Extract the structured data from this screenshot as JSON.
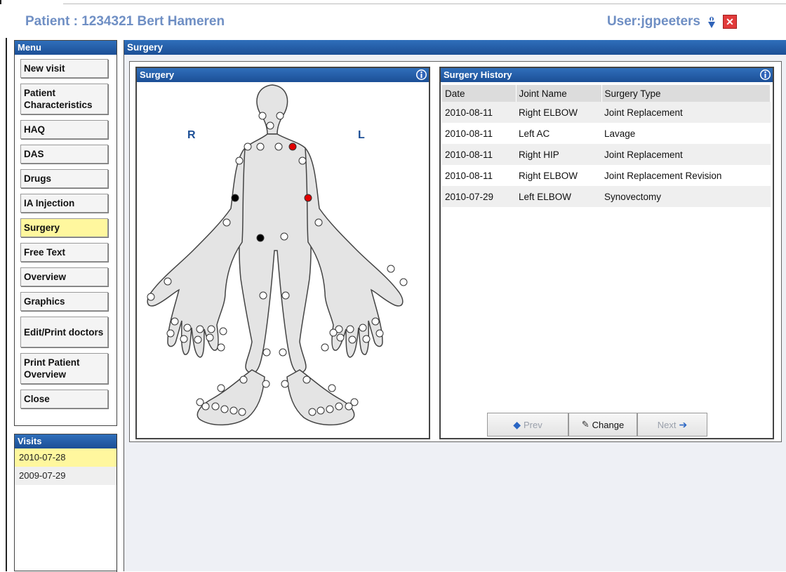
{
  "header": {
    "patient_title": "Patient : 1234321 Bert Hameren",
    "user_label": "User:jgpeeters",
    "info_icon": "info-icon",
    "close_icon": "close-icon"
  },
  "menu": {
    "title": "Menu",
    "items": [
      {
        "label": "New visit"
      },
      {
        "label": "Patient Characteristics"
      },
      {
        "label": "HAQ"
      },
      {
        "label": "DAS"
      },
      {
        "label": "Drugs"
      },
      {
        "label": "IA Injection"
      },
      {
        "label": "Surgery",
        "active": true
      },
      {
        "label": "Free Text"
      },
      {
        "label": "Overview"
      },
      {
        "label": "Graphics"
      },
      {
        "label": "Edit/Print doctors"
      },
      {
        "label": "Print Patient Overview"
      },
      {
        "label": "Close"
      }
    ]
  },
  "visits": {
    "title": "Visits",
    "items": [
      "2010-07-28",
      "2009-07-29"
    ],
    "selected_index": 0
  },
  "main": {
    "title": "Surgery"
  },
  "surgery_panel": {
    "title": "Surgery",
    "right_label": "R",
    "left_label": "L",
    "marker_colors": {
      "red": "#e00000",
      "black": "#000000",
      "normal": "#ffffff"
    }
  },
  "history": {
    "title": "Surgery History",
    "columns": [
      "Date",
      "Joint Name",
      "Surgery Type"
    ],
    "rows": [
      [
        "2010-08-11",
        "Right ELBOW",
        "Joint Replacement"
      ],
      [
        "2010-08-11",
        "Left AC",
        "Lavage"
      ],
      [
        "2010-08-11",
        "Right HIP",
        "Joint Replacement"
      ],
      [
        "2010-08-11",
        "Right ELBOW",
        "Joint Replacement Revision"
      ],
      [
        "2010-07-29",
        "Left ELBOW",
        "Synovectomy"
      ]
    ],
    "prev_label": "Prev",
    "change_label": "Change",
    "next_label": "Next"
  },
  "colors": {
    "header_blue": "#1c4f96",
    "title_blue": "#6f8fc4",
    "active_yellow": "#fff79e"
  }
}
